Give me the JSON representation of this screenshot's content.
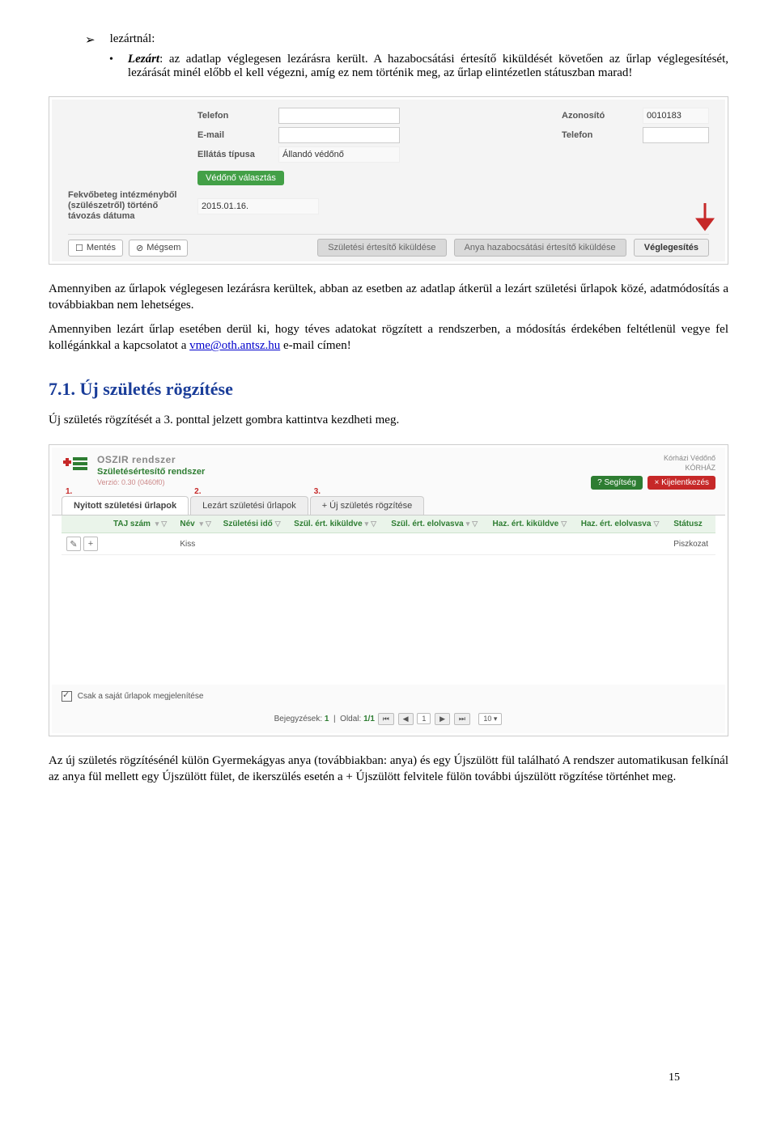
{
  "bullet": {
    "top_label": "lezártnál:",
    "sub_strong": "Lezárt",
    "sub_text": ": az adatlap véglegesen lezárásra került. A hazabocsátási értesítő kiküldését követően az űrlap véglegesítését, lezárását minél előbb el kell végezni, amíg ez nem történik meg, az űrlap elintézetlen státuszban marad!"
  },
  "shot1": {
    "labels": {
      "telefon": "Telefon",
      "email": "E-mail",
      "ellatas": "Ellátás típusa",
      "azon": "Azonosító",
      "azon_val": "0010183",
      "telefon2": "Telefon",
      "allando": "Állandó védőnő",
      "vedono_btn": "Védőnő választás",
      "fekvo": "Fekvőbeteg intézményből (szülészetről) történő távozás dátuma",
      "date": "2015.01.16."
    },
    "bar": {
      "mentes": "Mentés",
      "megsem": "Mégsem",
      "szul": "Születési értesítő kiküldése",
      "anya": "Anya hazabocsátási értesítő kiküldése",
      "vegl": "Véglegesítés"
    }
  },
  "para1": "Amennyiben az űrlapok véglegesen lezárásra kerültek, abban az esetben az adatlap átkerül a lezárt születési űrlapok közé, adatmódosítás a továbbiakban nem lehetséges.",
  "para2_a": "Amennyiben lezárt űrlap esetében derül ki, hogy téves adatokat rögzített a rendszerben, a módosítás érdekében feltétlenül vegye fel kollégánkkal a kapcsolatot a ",
  "para2_link": "vme@oth.antsz.hu",
  "para2_b": " e-mail címen!",
  "heading": "7.1. Új születés rögzítése",
  "para3": "Új születés rögzítését a 3. ponttal jelzett gombra kattintva kezdheti meg.",
  "shot2": {
    "brand1": "OSZIR rendszer",
    "brand2": "Születésértesítő rendszer",
    "brand3": "Verzió: 0.30 (0460f0)",
    "role1": "Kórházi Védőnő",
    "role2": "KÓRHÁZ",
    "help": "Segítség",
    "logout": "Kijelentkezés",
    "tabs": {
      "n1": "1.",
      "t1": "Nyitott születési űrlapok",
      "n2": "2.",
      "t2": "Lezárt születési űrlapok",
      "n3": "3.",
      "t3": "+ Új születés rögzítése"
    },
    "cols": {
      "c0": "",
      "c1": "TAJ szám ",
      "c2": "Név ",
      "c3": "Születési idő",
      "c4": "Szül. ért. kiküldve",
      "c5": "Szül. ért. elolvasva",
      "c6": "Haz. ért. kiküldve",
      "c7": "Haz. ért. elolvasva",
      "c8": "Státusz"
    },
    "row": {
      "name": "Kiss",
      "status": "Piszkozat"
    },
    "chk_label": "Csak a saját űrlapok megjelenítése",
    "pager": {
      "bej": "Bejegyzések:",
      "bej_n": "1",
      "oldal": "Oldal:",
      "oldal_v": "1/1",
      "page": "1",
      "size": "10"
    }
  },
  "para4": "Az új születés rögzítésénél külön Gyermekágyas anya (továbbiakban: anya) és egy Újszülött fül található A rendszer automatikusan felkínál az anya fül mellett egy Újszülött fület, de ikerszülés esetén a + Újszülött felvitele fülön további újszülött rögzítése történhet meg.",
  "page_num": "15"
}
